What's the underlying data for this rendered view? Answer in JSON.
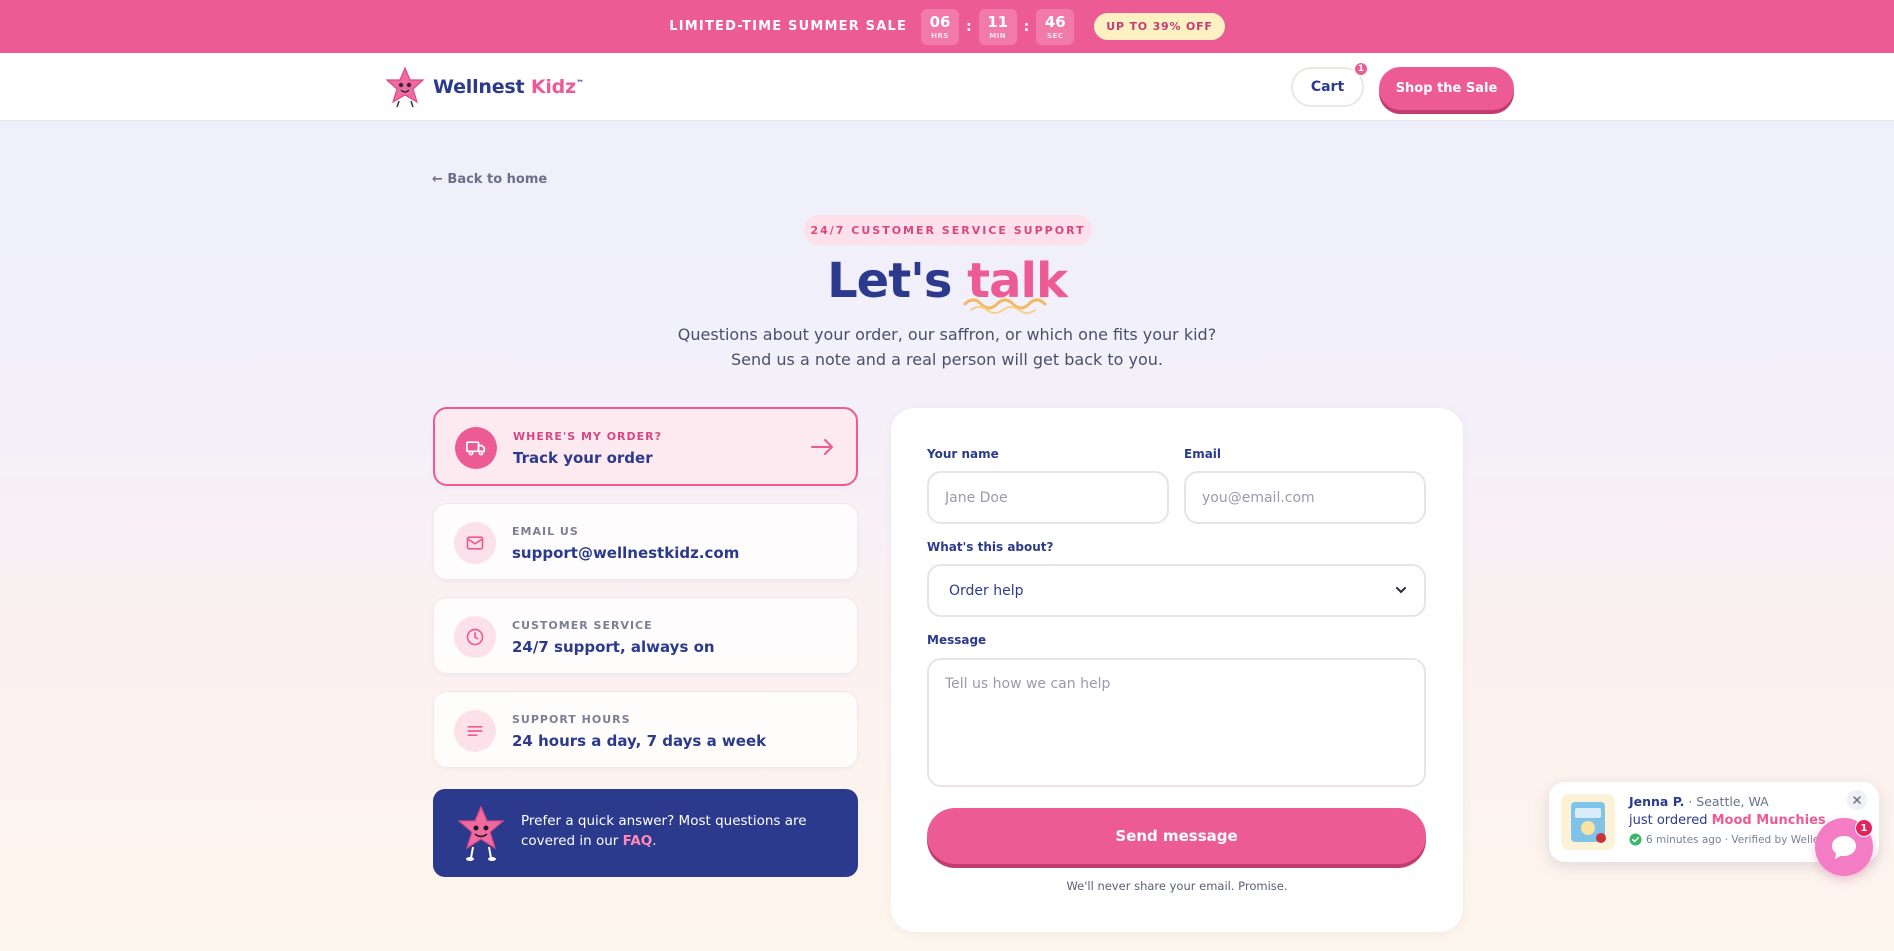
{
  "promo": {
    "text": "LIMITED-TIME SUMMER SALE",
    "timer": [
      {
        "value": "06",
        "unit": "HRS"
      },
      {
        "value": "11",
        "unit": "MIN"
      },
      {
        "value": "46",
        "unit": "SEC"
      }
    ],
    "pill": "UP TO 39% OFF"
  },
  "header": {
    "brand_main": "Wellnest",
    "brand_accent": "Kidz",
    "brand_tm": "™",
    "cart_label": "Cart",
    "cart_count": "1",
    "shop_label": "Shop the Sale"
  },
  "main": {
    "back_link": "← Back to home",
    "eyebrow": "24/7 CUSTOMER SERVICE SUPPORT",
    "headline_main": "Let's",
    "headline_accent": "talk",
    "subtitle_line1": "Questions about your order, our saffron, or which one fits your kid?",
    "subtitle_line2": "Send us a note and a real person will get back to you."
  },
  "cards": [
    {
      "label": "WHERE'S MY ORDER?",
      "value": "Track your order",
      "icon": "truck-icon"
    },
    {
      "label": "EMAIL US",
      "value": "support@wellnestkidz.com",
      "icon": "mail-icon"
    },
    {
      "label": "CUSTOMER SERVICE",
      "value": "24/7 support, always on",
      "icon": "clock-icon"
    },
    {
      "label": "SUPPORT HOURS",
      "value": "24 hours a day, 7 days a week",
      "icon": "lines-icon"
    }
  ],
  "faq": {
    "text": "Prefer a quick answer? Most questions are covered in our",
    "link": "FAQ",
    "suffix": "."
  },
  "form": {
    "name_label": "Your name",
    "name_placeholder": "Jane Doe",
    "email_label": "Email",
    "email_placeholder": "you@email.com",
    "topic_label": "What's this about?",
    "topic_value": "Order help",
    "message_label": "Message",
    "message_placeholder": "Tell us how we can help",
    "submit_label": "Send message",
    "privacy": "We'll never share your email. Promise."
  },
  "toast": {
    "name": "Jenna P.",
    "location": " · Seattle, WA",
    "action": "just ordered ",
    "product": "Mood Munchies",
    "meta": "6 minutes ago · Verified by Welle"
  },
  "chat": {
    "badge": "1"
  },
  "colors": {
    "brand_pink": "#ec5b94",
    "brand_navy": "#2b3a8c"
  }
}
